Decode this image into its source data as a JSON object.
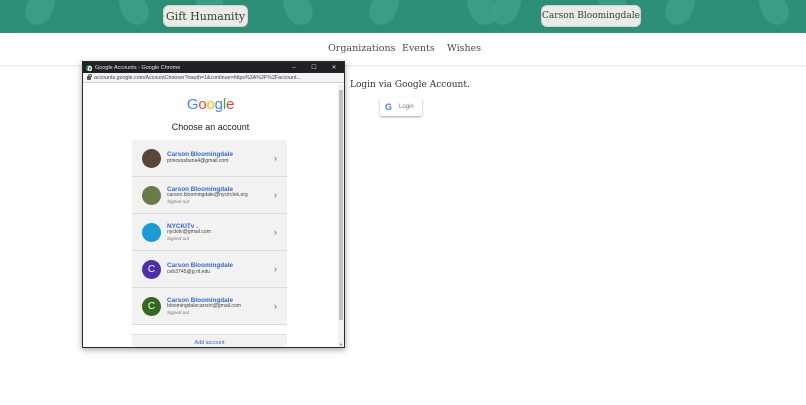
{
  "header": {
    "brand": "Gift Humanity",
    "user_name": "Carson Bloomingdale",
    "background_color": "#2e8f77"
  },
  "nav": {
    "items": [
      "Organizations",
      "Events",
      "Wishes"
    ]
  },
  "login": {
    "prompt": "Login via Google Account.",
    "button_label": "Login",
    "button_icon": "G"
  },
  "popup": {
    "window_title": "Google Accounts - Google Chrome",
    "window_controls": [
      "–",
      "☐",
      "✕"
    ],
    "url": "accounts.google.com/AccountChooser?oauth=1&continue=https%3A%2F%2Faccount...",
    "logo": [
      "G",
      "o",
      "o",
      "g",
      "l",
      "e"
    ],
    "logo_colors": [
      "#4285f4",
      "#ea4335",
      "#fbbc05",
      "#4285f4",
      "#34a853",
      "#ea4335"
    ],
    "heading": "Choose an account",
    "accounts": [
      {
        "name": "Carson Bloomingdale",
        "email": "princessbuna4@gmail.com",
        "status": "",
        "avatar_initial": "",
        "avatar_color": "#5a4636"
      },
      {
        "name": "Carson Bloomingdale",
        "email": "carson.bloomingdale@nycirclek.org",
        "status": "Signed out",
        "avatar_initial": "",
        "avatar_color": "#6b7a4a"
      },
      {
        "name": "NYCKITv .",
        "email": "nyckitv@gmail.com",
        "status": "Signed out",
        "avatar_initial": "",
        "avatar_color": "#1a9ad6"
      },
      {
        "name": "Carson Bloomingdale",
        "email": "ceb3745@g.rit.edu",
        "status": "",
        "avatar_initial": "C",
        "avatar_color": "#512da8"
      },
      {
        "name": "Carson Bloomingdale",
        "email": "bloomingdalecarson@gmail.com",
        "status": "Signed out",
        "avatar_initial": "C",
        "avatar_color": "#33691e"
      }
    ],
    "add_account": "Add account"
  }
}
